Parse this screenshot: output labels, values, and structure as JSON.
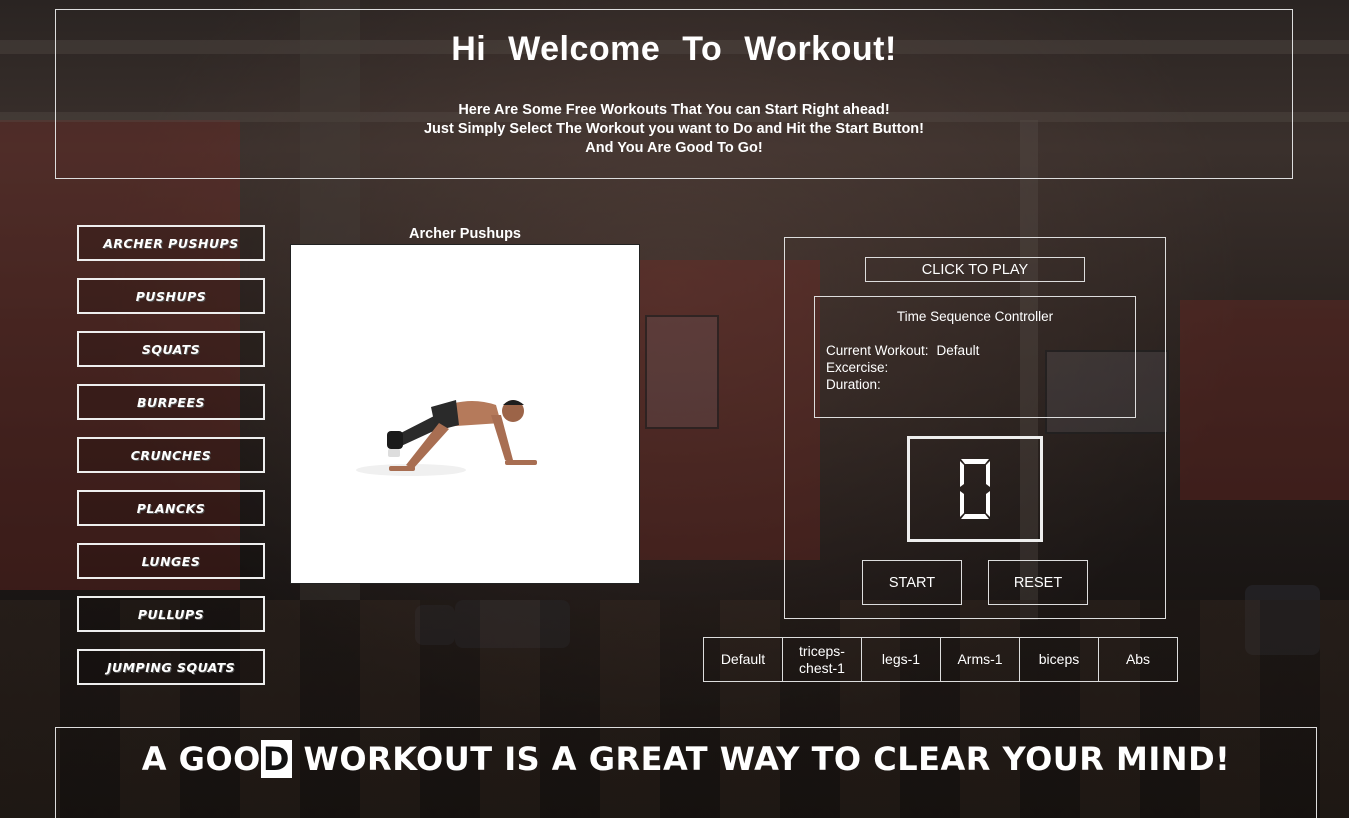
{
  "header": {
    "title": "Hi  Welcome  To   Workout!",
    "line1": "Here Are Some Free Workouts That You can Start Right ahead!",
    "line2": "Just Simply Select The Workout you want to Do and Hit the Start Button!",
    "line3": "And You Are Good To Go!"
  },
  "exercises": [
    {
      "label": "ARCHER PUSHUPS"
    },
    {
      "label": "PUSHUPS"
    },
    {
      "label": "SQUATS"
    },
    {
      "label": "BURPEES"
    },
    {
      "label": "CRUNCHES"
    },
    {
      "label": "PLANCKS"
    },
    {
      "label": "LUNGES"
    },
    {
      "label": "PULLUPS"
    },
    {
      "label": "JUMPING SQUATS"
    }
  ],
  "preview": {
    "title": "Archer Pushups"
  },
  "controller": {
    "play_label": "CLICK TO PLAY",
    "title": "Time Sequence Controller",
    "current_workout_label": "Current Workout:",
    "current_workout_value": "Default",
    "exercise_label": "Excercise:",
    "exercise_value": "",
    "duration_label": "Duration:",
    "duration_value": "",
    "digit": "0",
    "start_label": "START",
    "reset_label": "RESET"
  },
  "workout_tabs": [
    {
      "label": "Default"
    },
    {
      "label": "triceps-chest-1"
    },
    {
      "label": "legs-1"
    },
    {
      "label": "Arms-1"
    },
    {
      "label": "biceps"
    },
    {
      "label": "Abs"
    }
  ],
  "footer": {
    "before": "A GOO",
    "highlight": "D",
    "after": " WORKOUT IS A GREAT WAY TO CLEAR YOUR MIND!"
  }
}
